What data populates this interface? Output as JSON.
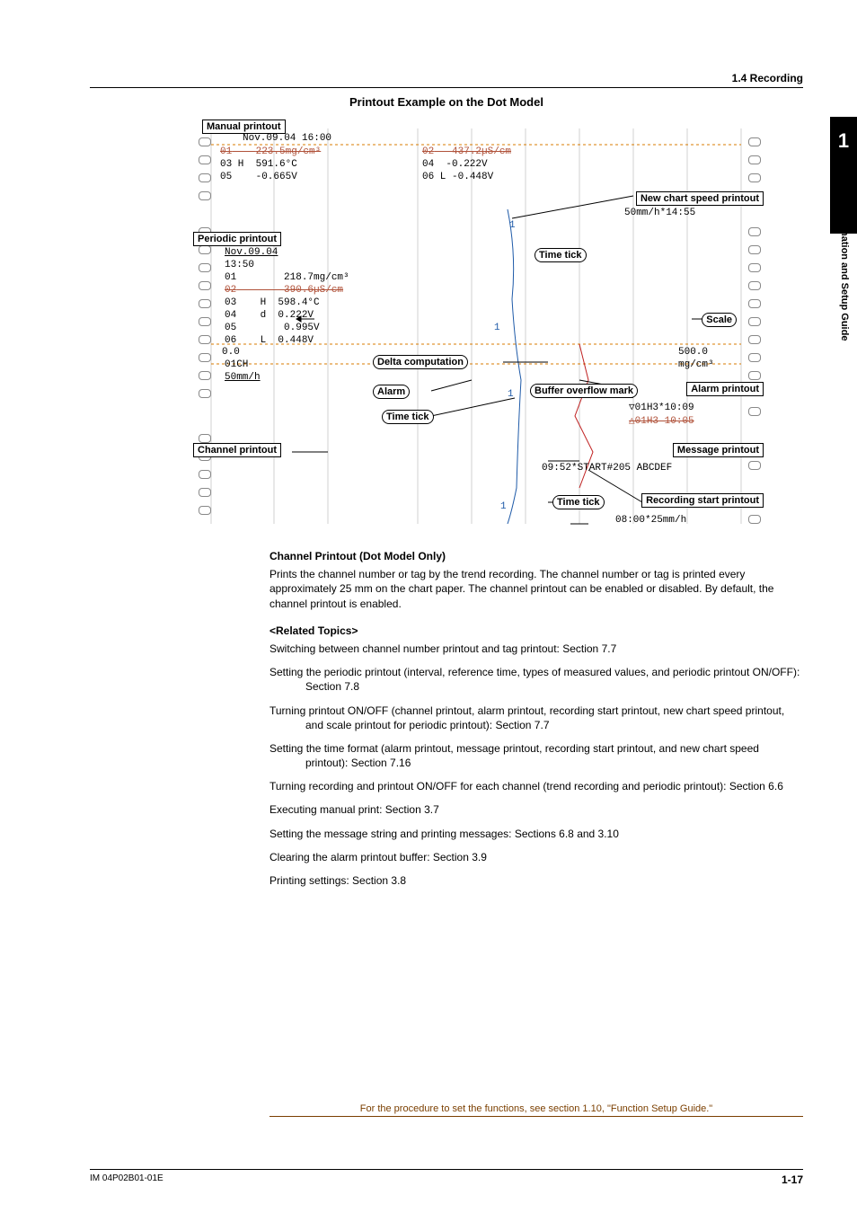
{
  "header": {
    "section": "1.4  Recording"
  },
  "side_tab": {
    "chapter": "1",
    "title": "Functional Explanation and Setup Guide"
  },
  "figure": {
    "title": "Printout Example on the Dot Model",
    "labels": {
      "manual_printout": "Manual printout",
      "periodic_printout": "Periodic printout",
      "channel_printout": "Channel printout",
      "new_chart_speed_printout": "New chart speed printout",
      "time_tick": "Time tick",
      "scale": "Scale",
      "delta_computation": "Delta computation",
      "alarm": "Alarm",
      "buffer_overflow_mark": "Buffer overflow mark",
      "alarm_printout": "Alarm printout",
      "message_printout": "Message printout",
      "recording_start_printout": "Recording start printout"
    },
    "manual": {
      "datetime": "Nov.09.04 16:00",
      "r1": [
        "01",
        "223.5mg/cm³",
        "02",
        "437.2µS/cm"
      ],
      "r2": [
        "03 H",
        "591.6°C",
        "04",
        "-0.222V"
      ],
      "r3": [
        "05",
        "-0.665V",
        "06 L",
        "-0.448V"
      ]
    },
    "new_chart_speed": "50mm/h*14:55",
    "periodic": {
      "date": "Nov.09.04",
      "time": "13:50",
      "rows": [
        [
          "01",
          "",
          "218.7mg/cm³"
        ],
        [
          "02",
          "",
          "390.6µS/cm"
        ],
        [
          "03",
          "H",
          "598.4°C"
        ],
        [
          "04",
          "d",
          "0.222V"
        ],
        [
          "05",
          "",
          "0.995V"
        ],
        [
          "06",
          "L",
          "0.448V"
        ]
      ],
      "scale_left": "0.0",
      "scale_right": "500.0",
      "ch": "01CH",
      "unit": "mg/cm³",
      "speed": "50mm/h"
    },
    "alarm_lines": [
      "▽01H3*10:09",
      "△01H3 10:05"
    ],
    "message_line": "09:52*START#205 ABCDEF",
    "rec_start": "08:00*25mm/h",
    "tick_numbers": [
      "1",
      "1",
      "1",
      "1"
    ]
  },
  "body": {
    "heading": "Channel Printout (Dot Model Only)",
    "para": "Prints the channel number or tag by the trend recording. The channel number or tag is printed every approximately 25 mm on the chart paper. The channel printout can be enabled or disabled. By default, the channel printout is enabled.",
    "related_heading": "<Related Topics>",
    "related": [
      "Switching between channel number printout and tag printout: Section 7.7",
      "Setting the periodic printout (interval, reference time, types of measured values, and periodic printout ON/OFF): Section 7.8",
      "Turning printout ON/OFF (channel printout, alarm printout, recording start printout, new chart speed printout, and scale printout for periodic printout): Section 7.7",
      "Setting the time format (alarm printout, message printout, recording start printout, and new chart speed printout): Section 7.16",
      "Turning recording and printout ON/OFF for each channel (trend recording and periodic printout): Section 6.6",
      "Executing manual print: Section 3.7",
      "Setting the message string and printing messages: Sections 6.8 and 3.10",
      "Clearing the alarm printout buffer: Section 3.9",
      "Printing settings: Section 3.8"
    ]
  },
  "footer_note": "For the procedure to set the functions, see section 1.10, \"Function Setup Guide.\"",
  "footer": {
    "left": "IM 04P02B01-01E",
    "right": "1-17"
  }
}
